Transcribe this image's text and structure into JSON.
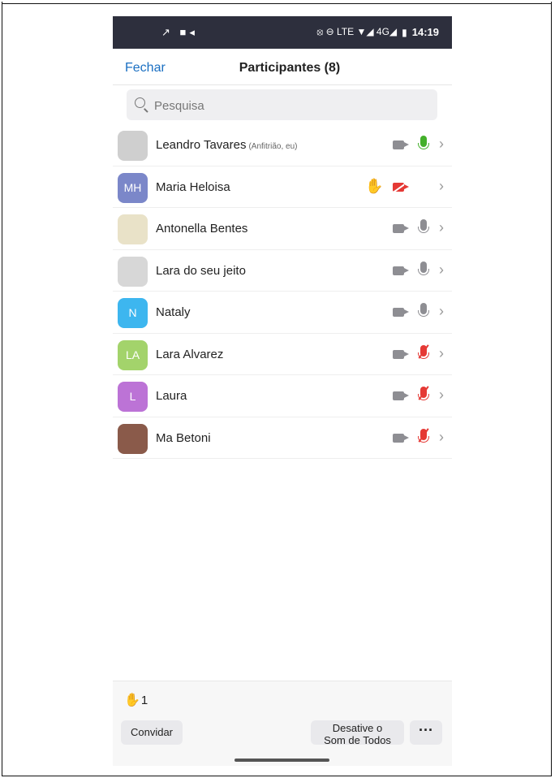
{
  "status_bar": {
    "left_icons": "↗ ■◂",
    "right_icons": "⦻ ⊖ LTE ▼◢ 4G◢",
    "battery": "▮",
    "time": "14:19"
  },
  "header": {
    "close_label": "Fechar",
    "title": "Participantes (8)"
  },
  "search": {
    "placeholder": "Pesquisa",
    "value": ""
  },
  "participants": [
    {
      "name": "Leandro Tavares",
      "role": "(Anfitrião, eu)",
      "avatar_initials": "",
      "avatar_color": "#cfcfcf",
      "hand_raised": false,
      "video": "on",
      "audio": "on"
    },
    {
      "name": "Maria Heloisa",
      "role": "",
      "avatar_initials": "MH",
      "avatar_color": "#7b87c9",
      "hand_raised": true,
      "video": "off",
      "audio": "none"
    },
    {
      "name": "Antonella Bentes",
      "role": "",
      "avatar_initials": "",
      "avatar_color": "#e9e2c8",
      "hand_raised": false,
      "video": "on",
      "audio": "unmuted"
    },
    {
      "name": "Lara do seu jeito",
      "role": "",
      "avatar_initials": "",
      "avatar_color": "#d7d7d7",
      "hand_raised": false,
      "video": "on",
      "audio": "unmuted"
    },
    {
      "name": "Nataly",
      "role": "",
      "avatar_initials": "N",
      "avatar_color": "#3db6ef",
      "hand_raised": false,
      "video": "on",
      "audio": "unmuted"
    },
    {
      "name": "Lara Alvarez",
      "role": "",
      "avatar_initials": "LA",
      "avatar_color": "#a3d36b",
      "hand_raised": false,
      "video": "on",
      "audio": "muted"
    },
    {
      "name": "Laura",
      "role": "",
      "avatar_initials": "L",
      "avatar_color": "#bc73d6",
      "hand_raised": false,
      "video": "on",
      "audio": "muted"
    },
    {
      "name": "Ma Betoni",
      "role": "",
      "avatar_initials": "",
      "avatar_color": "#8a5a4a",
      "hand_raised": false,
      "video": "on",
      "audio": "muted"
    }
  ],
  "footer": {
    "raised_hand_icon": "✋",
    "raised_hand_count": "1",
    "invite_label": "Convidar",
    "mute_all_line1": "Desative o",
    "mute_all_line2": "Som de Todos",
    "more_label": "···"
  },
  "icons": {
    "hand": "✋",
    "chevron": "›"
  },
  "colors": {
    "accent": "#1a6fc2",
    "status_bar_bg": "#2d2f3d",
    "mic_on": "#43b02a",
    "muted": "#e53935",
    "hand": "#f2b705"
  }
}
